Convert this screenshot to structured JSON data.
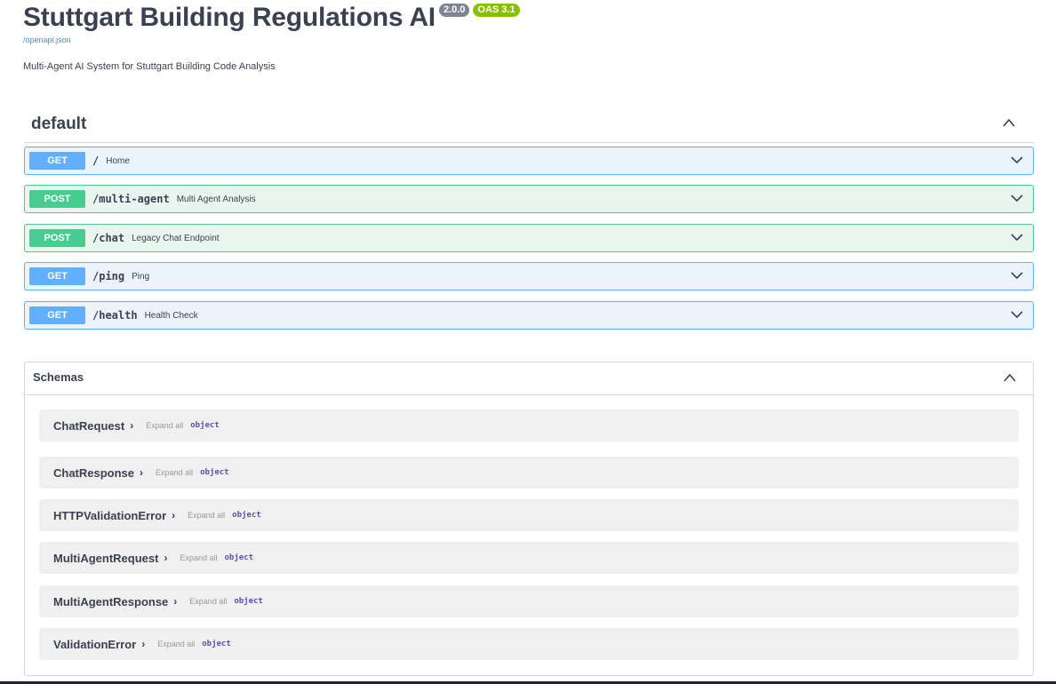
{
  "header": {
    "title": "Stuttgart Building Regulations AI",
    "version_badge": "2.0.0",
    "oas_badge": "OAS 3.1",
    "spec_link": "/openapi.json",
    "description": "Multi-Agent AI System for Stuttgart Building Code Analysis"
  },
  "tag": {
    "name": "default"
  },
  "operations": [
    {
      "method": "GET",
      "path": "/",
      "summary": "Home"
    },
    {
      "method": "POST",
      "path": "/multi-agent",
      "summary": "Multi Agent Analysis"
    },
    {
      "method": "POST",
      "path": "/chat",
      "summary": "Legacy Chat Endpoint"
    },
    {
      "method": "GET",
      "path": "/ping",
      "summary": "Ping"
    },
    {
      "method": "GET",
      "path": "/health",
      "summary": "Health Check"
    }
  ],
  "schemas": {
    "title": "Schemas",
    "expand_label": "Expand all",
    "models": [
      {
        "name": "ChatRequest",
        "type": "object"
      },
      {
        "name": "ChatResponse",
        "type": "object"
      },
      {
        "name": "HTTPValidationError",
        "type": "object"
      },
      {
        "name": "MultiAgentRequest",
        "type": "object"
      },
      {
        "name": "MultiAgentResponse",
        "type": "object"
      },
      {
        "name": "ValidationError",
        "type": "object"
      }
    ]
  },
  "icons": {
    "collapse": "chevron-up-icon",
    "expand": "chevron-down-icon",
    "model_expand": "chevron-right-icon"
  },
  "colors": {
    "get": "#61affe",
    "post": "#49cc90",
    "version_badge": "#7d8492",
    "oas_badge": "#89bf04"
  }
}
